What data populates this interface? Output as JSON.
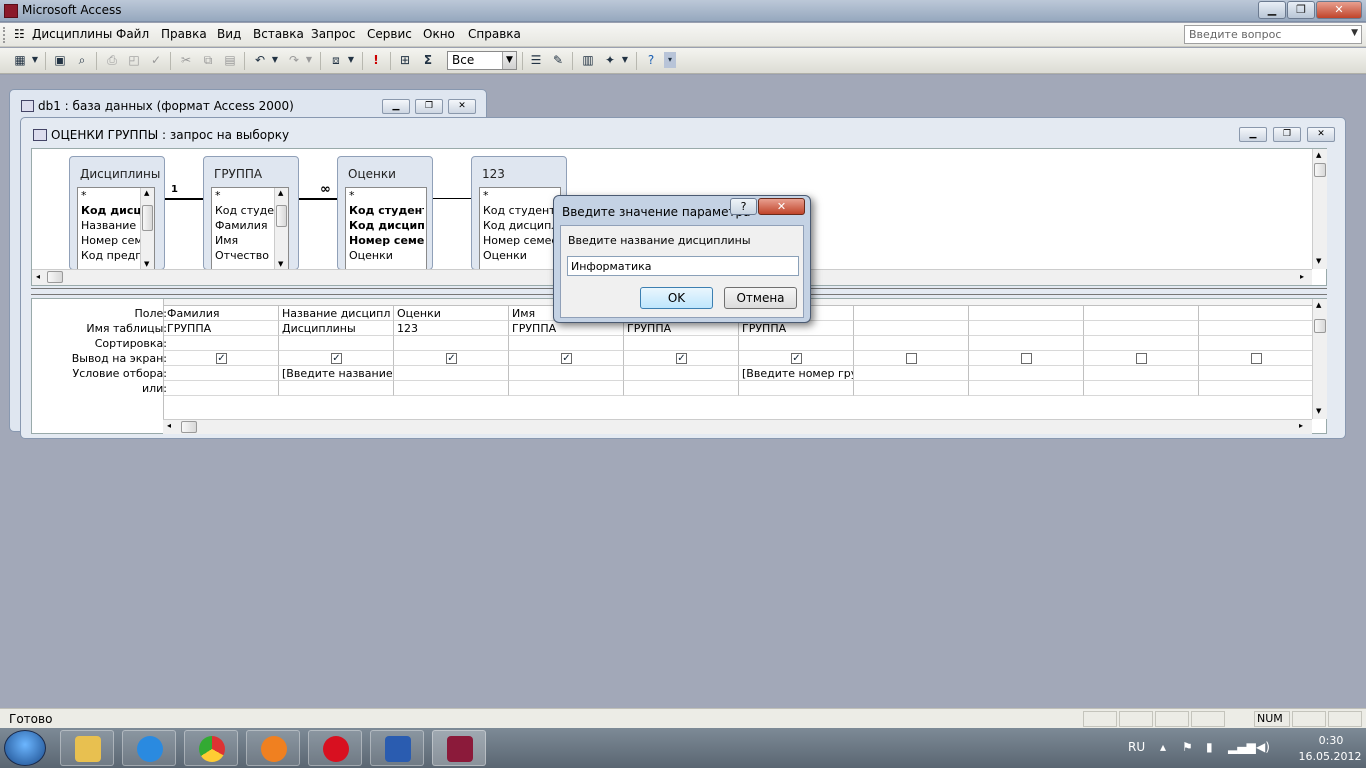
{
  "app": {
    "title": "Microsoft Access"
  },
  "menu": {
    "items": [
      "Дисциплины",
      "Файл",
      "Правка",
      "Вид",
      "Вставка",
      "Запрос",
      "Сервис",
      "Окно",
      "Справка"
    ],
    "ask_placeholder": "Введите вопрос"
  },
  "toolbar": {
    "top_values": "Все"
  },
  "db_window": {
    "title": "db1 : база данных (формат Access 2000)"
  },
  "query_window": {
    "title": "ОЦЕНКИ ГРУППЫ : запрос на выборку"
  },
  "tables": [
    {
      "name": "Дисциплины",
      "fields": [
        "*",
        "Код дисциплины",
        "Название дисциплины",
        "Номер семестра",
        "Код предпосылки"
      ],
      "bold": [
        1
      ]
    },
    {
      "name": "ГРУППА",
      "fields": [
        "*",
        "Код студента",
        "Фамилия",
        "Имя",
        "Отчество"
      ],
      "bold": []
    },
    {
      "name": "Оценки",
      "fields": [
        "*",
        "Код студента",
        "Код дисциплины",
        "Номер семестра",
        "Оценки"
      ],
      "bold": [
        1,
        2,
        3
      ]
    },
    {
      "name": "123",
      "fields": [
        "*",
        "Код студента",
        "Код дисциплины",
        "Номер семестра",
        "Оценки"
      ],
      "bold": []
    }
  ],
  "relations": {
    "one": "1",
    "many": "∞"
  },
  "grid": {
    "row_labels": [
      "Поле:",
      "Имя таблицы:",
      "Сортировка:",
      "Вывод на экран:",
      "Условие отбора:",
      "или:"
    ],
    "columns": [
      {
        "field": "Фамилия",
        "table": "ГРУППА",
        "show": true,
        "criteria": ""
      },
      {
        "field": "Название дисципл",
        "table": "Дисциплины",
        "show": true,
        "criteria": "[Введите название ди"
      },
      {
        "field": "Оценки",
        "table": "123",
        "show": true,
        "criteria": ""
      },
      {
        "field": "Имя",
        "table": "ГРУППА",
        "show": true,
        "criteria": ""
      },
      {
        "field": "",
        "table": "ГРУППА",
        "show": true,
        "criteria": ""
      },
      {
        "field": "",
        "table": "ГРУППА",
        "show": true,
        "criteria": "[Введите номер групп"
      },
      {
        "field": "",
        "table": "",
        "show": false,
        "criteria": ""
      },
      {
        "field": "",
        "table": "",
        "show": false,
        "criteria": ""
      },
      {
        "field": "",
        "table": "",
        "show": false,
        "criteria": ""
      },
      {
        "field": "",
        "table": "",
        "show": false,
        "criteria": ""
      }
    ]
  },
  "dialog": {
    "title": "Введите значение параметра",
    "prompt": "Введите название дисциплины",
    "value": "Информатика",
    "ok": "OK",
    "cancel": "Отмена",
    "help": "?",
    "close": "✕"
  },
  "status": {
    "text": "Готово",
    "num": "NUM"
  },
  "taskbar": {
    "lang": "RU",
    "time": "0:30",
    "date": "16.05.2012"
  }
}
